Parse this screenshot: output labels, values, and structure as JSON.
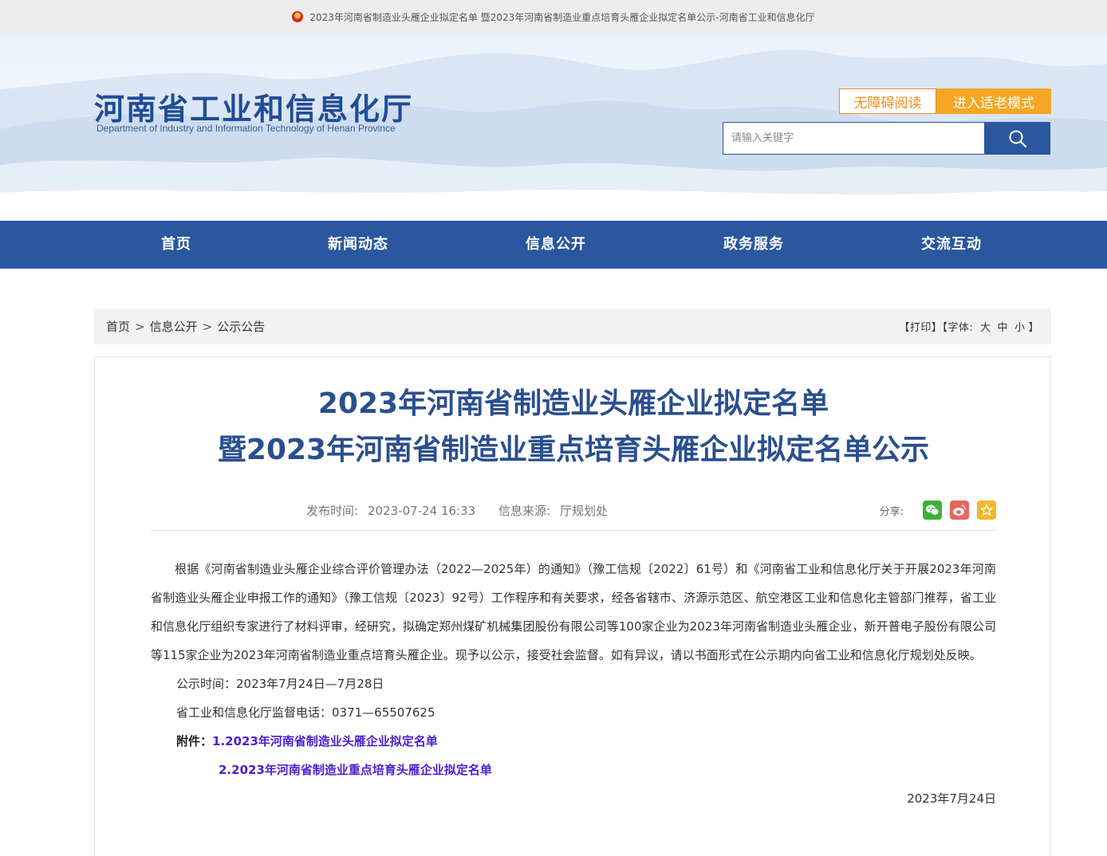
{
  "topbar": {
    "text": "2023年河南省制造业头雁企业拟定名单 暨2023年河南省制造业重点培育头雁企业拟定名单公示-河南省工业和信息化厅"
  },
  "header": {
    "site_title": "河南省工业和信息化厅",
    "site_subtitle": "Department of Industry and Information Technology of Henan Province",
    "accessibility_label": "无障碍阅读",
    "elder_mode_label": "进入适老模式",
    "search_placeholder": "请输入关键字"
  },
  "nav": {
    "items": [
      {
        "label": "首页"
      },
      {
        "label": "新闻动态"
      },
      {
        "label": "信息公开"
      },
      {
        "label": "政务服务"
      },
      {
        "label": "交流互动"
      }
    ]
  },
  "breadcrumb": {
    "items": [
      "首页",
      "信息公开",
      "公示公告"
    ],
    "sep": ">"
  },
  "tools": {
    "print": "【打印】",
    "font_label": "【字体:",
    "large": "大",
    "medium": "中",
    "small": "小",
    "close": "】"
  },
  "article": {
    "title_line1": "2023年河南省制造业头雁企业拟定名单",
    "title_line2": "暨2023年河南省制造业重点培育头雁企业拟定名单公示",
    "publish_label": "发布时间:",
    "publish_time": "2023-07-24 16:33",
    "source_label": "信息来源:",
    "source": "厅规划处",
    "share_label": "分享:",
    "paragraph": "根据《河南省制造业头雁企业综合评价管理办法（2022—2025年）的通知》（豫工信规〔2022〕61号）和《河南省工业和信息化厅关于开展2023年河南省制造业头雁企业申报工作的通知》（豫工信规〔2023〕92号）工作程序和有关要求，经各省辖市、济源示范区、航空港区工业和信息化主管部门推荐，省工业和信息化厅组织专家进行了材料评审，经研究，拟确定郑州煤矿机械集团股份有限公司等100家企业为2023年河南省制造业头雁企业，新开普电子股份有限公司等115家企业为2023年河南省制造业重点培育头雁企业。现予以公示，接受社会监督。如有异议，请以书面形式在公示期内向省工业和信息化厅规划处反映。",
    "notice_period": "公示时间：2023年7月24日—7月28日",
    "hotline": "省工业和信息化厅监督电话：0371—65507625",
    "attachment_label": "附件：",
    "attachment1": "1.2023年河南省制造业头雁企业拟定名单",
    "attachment2": "2.2023年河南省制造业重点培育头雁企业拟定名单",
    "date": "2023年7月24日"
  },
  "colors": {
    "primary": "#2a579f",
    "accent": "#f5a623",
    "title": "#2a4f8f",
    "link": "#4b1fd6"
  }
}
